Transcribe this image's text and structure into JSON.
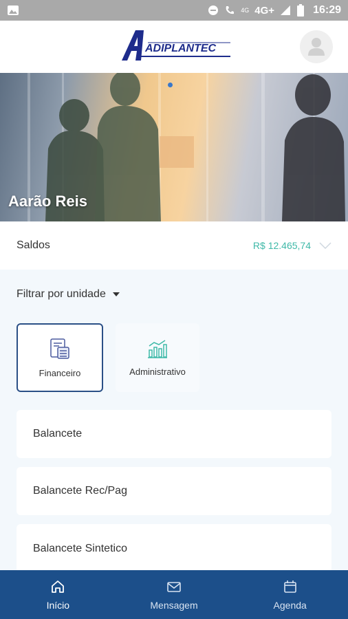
{
  "status_bar": {
    "time": "16:29",
    "network": "4G+",
    "network_small": "4G"
  },
  "header": {
    "logo_text": "ADIPLANTEC"
  },
  "hero": {
    "name": "Aarão Reis"
  },
  "saldos": {
    "label": "Saldos",
    "value": "R$ 12.465,74"
  },
  "filter": {
    "label": "Filtrar por unidade"
  },
  "tabs": [
    {
      "label": "Financeiro",
      "active": true
    },
    {
      "label": "Administrativo",
      "active": false
    }
  ],
  "reports": [
    {
      "label": "Balancete"
    },
    {
      "label": "Balancete Rec/Pag"
    },
    {
      "label": "Balancete Sintetico"
    }
  ],
  "bottom_nav": [
    {
      "label": "Início",
      "icon": "home-icon",
      "active": true
    },
    {
      "label": "Mensagem",
      "icon": "mail-icon",
      "active": false
    },
    {
      "label": "Agenda",
      "icon": "calendar-icon",
      "active": false
    }
  ],
  "colors": {
    "primary": "#1c4f8a",
    "accent": "#3fb9a8",
    "background": "#f3f8fc"
  }
}
